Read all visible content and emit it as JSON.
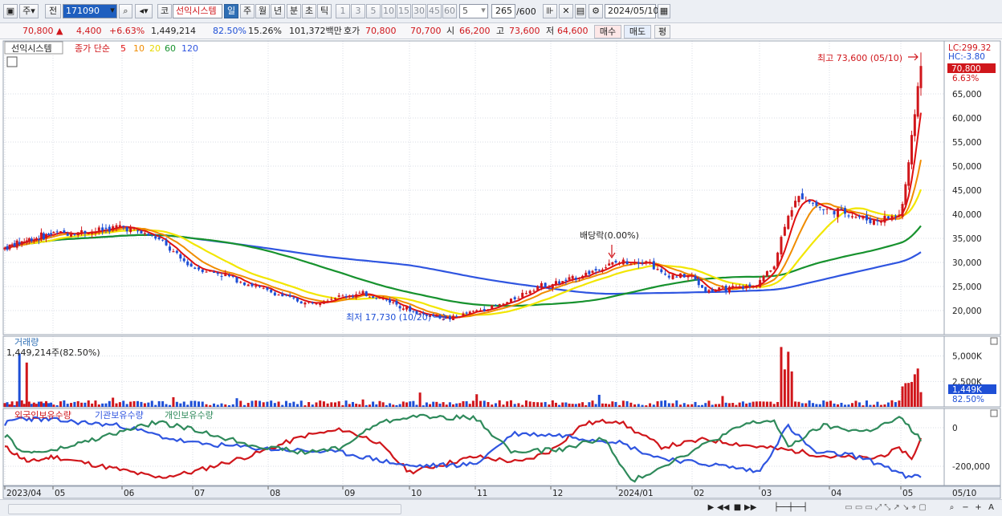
{
  "toolbar": {
    "market": "주",
    "prefix": "전",
    "code": "171090",
    "code_btn": "코",
    "name": "선익시스템",
    "periods": [
      "일",
      "주",
      "월",
      "년",
      "분",
      "초",
      "틱"
    ],
    "active_period": "일",
    "intervals": [
      "1",
      "3",
      "5",
      "10",
      "15",
      "30",
      "45",
      "60"
    ],
    "interval_value": "5",
    "count": "265",
    "count_total": "/600",
    "date": "2024/05/10"
  },
  "quote": {
    "price": "70,800",
    "change": "4,400",
    "change_pct": "+6.63%",
    "volume": "1,449,214",
    "vol_ratio": "82.50%",
    "turnover": "15.26%",
    "amount": "101,372백만",
    "ask_label": "호가",
    "ask": "70,800",
    "bid": "70,700",
    "open_label": "시",
    "open": "66,200",
    "high_label": "고",
    "high": "73,600",
    "low_label": "저",
    "low": "64,600",
    "buy": "매수",
    "sell": "매도",
    "avg": "평"
  },
  "colors": {
    "up": "#d0161b",
    "down": "#1e4fd6",
    "ma5": "#e01010",
    "ma10": "#f08c00",
    "ma20": "#f2e600",
    "ma60": "#17922e",
    "ma120": "#2f55e0",
    "foreign": "#d0161b",
    "inst": "#2f55e0",
    "indiv": "#2f8a5b"
  },
  "chart_data": [
    {
      "type": "candlestick",
      "title": "선익시스템",
      "legend": [
        "종가 단순",
        "5",
        "10",
        "20",
        "60",
        "120"
      ],
      "x_ticks": [
        "2023/04",
        "05",
        "06",
        "07",
        "08",
        "09",
        "10",
        "11",
        "12",
        "2024/01",
        "02",
        "03",
        "04",
        "05"
      ],
      "x_last": "05/10",
      "y_ticks": [
        20000,
        25000,
        30000,
        35000,
        40000,
        45000,
        50000,
        55000,
        60000,
        65000
      ],
      "y_tick_labels": [
        "20,000",
        "25,000",
        "30,000",
        "35,000",
        "40,000",
        "45,000",
        "50,000",
        "55,000",
        "60,000",
        "65,000"
      ],
      "ylim": [
        15000,
        76000
      ],
      "series_close_approx": {
        "x": [
          "2023-04",
          "2023-05",
          "2023-06",
          "2023-07",
          "2023-08",
          "2023-09",
          "2023-10",
          "2023-11",
          "2023-12",
          "2024-01",
          "2024-02",
          "2024-03",
          "2024-04",
          "2024-05-10"
        ],
        "close": [
          33000,
          36000,
          37000,
          29000,
          24000,
          22500,
          19000,
          22000,
          27000,
          30500,
          24000,
          25000,
          41000,
          70800
        ]
      },
      "annotations": {
        "max": "최고 73,600 (05/10)",
        "min": "최저 17,730 (10/20)",
        "dividend": "배당락(0.00%)",
        "lc": "LC:299.32",
        "hc": "HC:-3.80",
        "last_price": "70,800",
        "last_pct": "6.63%"
      }
    },
    {
      "type": "bar",
      "title": "거래량",
      "value_label": "1,449,214주(82.50%)",
      "y_tick_labels": [
        "5,000K",
        "2,500K"
      ],
      "y_ticks": [
        5000000,
        2500000
      ],
      "last_value_label": "1,449K",
      "last_pct": "82.50%"
    },
    {
      "type": "line",
      "series": [
        {
          "name": "외국인보유수량"
        },
        {
          "name": "기관보유수량"
        },
        {
          "name": "개인보유수량"
        }
      ],
      "y_tick_labels": [
        "0",
        "-200,000"
      ],
      "y_ticks": [
        0,
        -200000
      ]
    }
  ]
}
